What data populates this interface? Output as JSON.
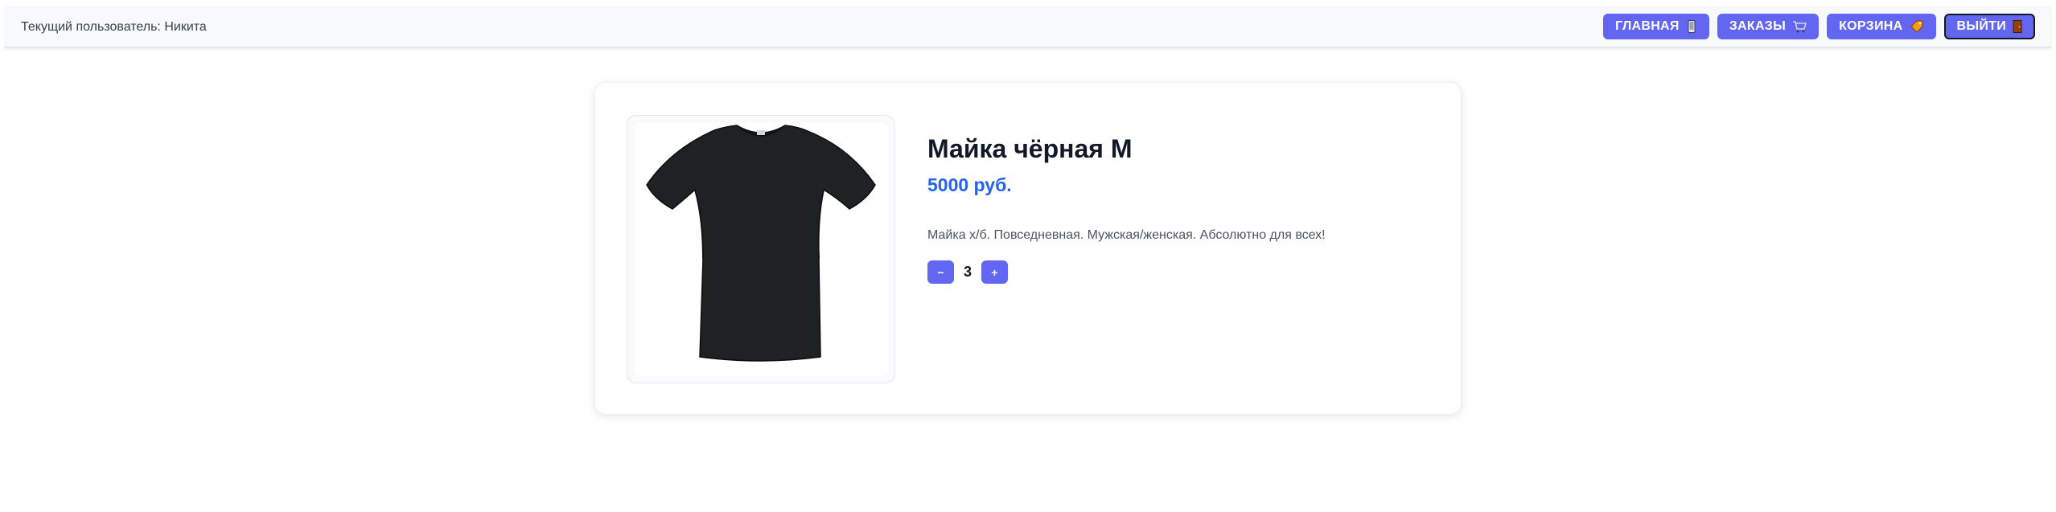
{
  "header": {
    "current_user": "Текущий пользователь: Никита",
    "nav": [
      {
        "label": "ГЛАВНАЯ",
        "icon": "phone-icon"
      },
      {
        "label": "ЗАКАЗЫ",
        "icon": "cart-icon"
      },
      {
        "label": "КОРЗИНА",
        "icon": "tag-icon"
      },
      {
        "label": "ВЫЙТИ",
        "icon": "door-icon"
      }
    ]
  },
  "product": {
    "title": "Майка чёрная M",
    "price": "5000 руб.",
    "description": "Майка х/б. Повседневная. Мужская/женская. Абсолютно для всех!",
    "image": "black-tshirt-image",
    "quantity": "3",
    "decrement_label": "−",
    "increment_label": "+"
  },
  "colors": {
    "accent": "#6366f1",
    "price": "#2563eb"
  }
}
